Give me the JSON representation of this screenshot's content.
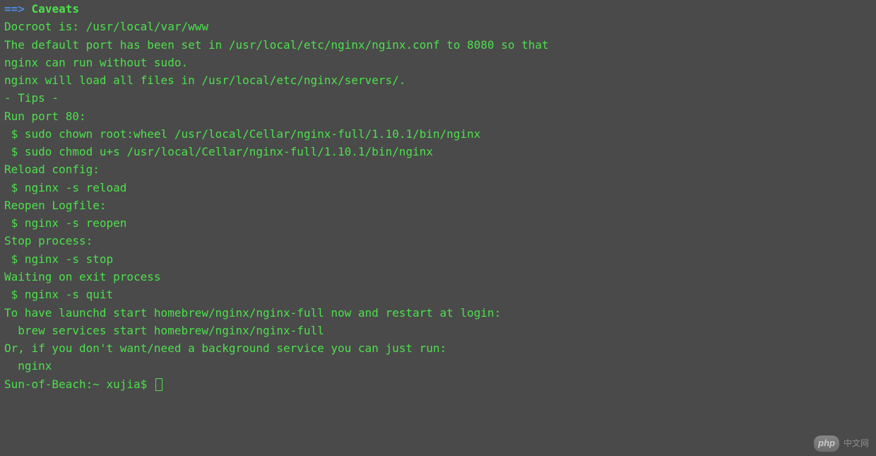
{
  "header": {
    "arrow": "==>",
    "title": "Caveats"
  },
  "lines": {
    "docroot": "Docroot is: /usr/local/var/www",
    "blank": "",
    "port1": "The default port has been set in /usr/local/etc/nginx/nginx.conf to 8080 so that",
    "port2": "nginx can run without sudo.",
    "loadfiles": "nginx will load all files in /usr/local/etc/nginx/servers/.",
    "tips": "- Tips -",
    "runport": "Run port 80:",
    "chown": " $ sudo chown root:wheel /usr/local/Cellar/nginx-full/1.10.1/bin/nginx",
    "chmod": " $ sudo chmod u+s /usr/local/Cellar/nginx-full/1.10.1/bin/nginx",
    "reload_label": "Reload config:",
    "reload_cmd": " $ nginx -s reload",
    "reopen_label": "Reopen Logfile:",
    "reopen_cmd": " $ nginx -s reopen",
    "stop_label": "Stop process:",
    "stop_cmd": " $ nginx -s stop",
    "wait_label": "Waiting on exit process",
    "quit_cmd": " $ nginx -s quit",
    "launchd1": "To have launchd start homebrew/nginx/nginx-full now and restart at login:",
    "launchd2": "  brew services start homebrew/nginx/nginx-full",
    "or1": "Or, if you don't want/need a background service you can just run:",
    "or2": "  nginx",
    "prompt": "Sun-of-Beach:~ xujia$ "
  },
  "watermark": {
    "badge": "php",
    "text": "中文网"
  }
}
